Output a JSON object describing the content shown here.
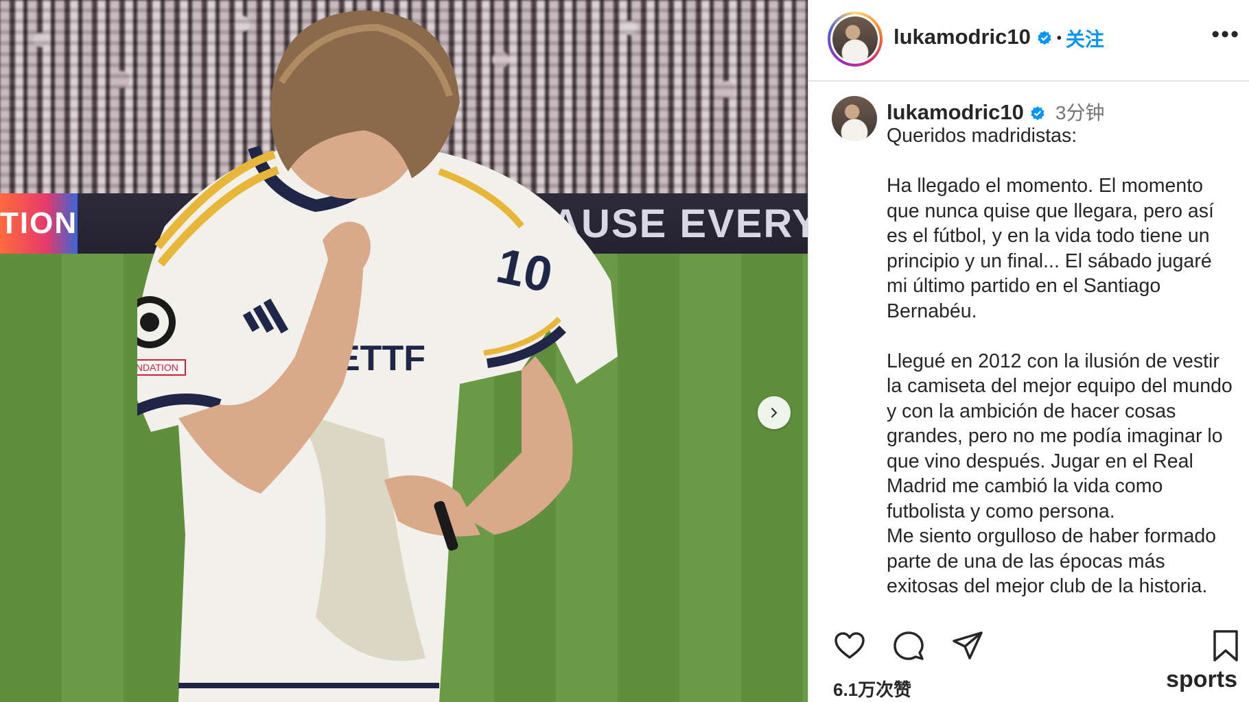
{
  "post": {
    "username": "lukamodric10",
    "follow_label": "关注",
    "dot": "•",
    "more_label": "•••",
    "time_ago": "3分钟",
    "caption": "Queridos madridistas:\n\nHa llegado el momento. El momento que nunca quise que llegara, pero así es el fútbol, y en la vida todo tiene un principio y un final... El sábado jugaré mi último partido en el Santiago Bernabéu.\n\nLlegué en 2012 con la ilusión de vestir la camiseta del mejor equipo del mundo y con la ambición de hacer cosas grandes, pero no me podía imaginar lo que vino después. Jugar en el Real Madrid me cambió la vida como futbolista y como persona.\nMe siento orgulloso de haber formado parte de una de las épocas más exitosas del mejor club de la historia.",
    "likes": "6.1万次赞"
  },
  "photo": {
    "board_left": "TION",
    "board_right": "AUSE EVERY CH",
    "patch_text": "INDATION"
  },
  "watermark": "sports",
  "icons": {
    "verified": "verified-badge-icon",
    "like": "heart-icon",
    "comment": "comment-bubble-icon",
    "share": "paper-plane-icon",
    "save": "bookmark-icon",
    "next": "chevron-right-icon"
  },
  "colors": {
    "link_blue": "#0095f6",
    "text": "#262626",
    "muted": "#737373"
  }
}
